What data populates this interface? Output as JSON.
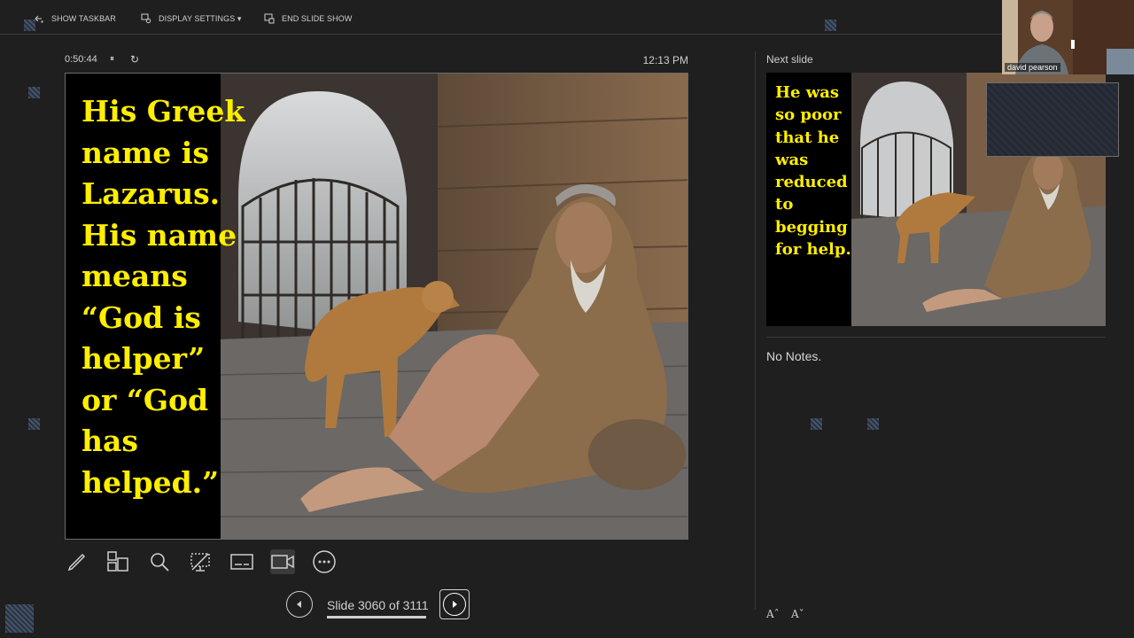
{
  "toolbar": {
    "show_taskbar": "SHOW TASKBAR",
    "display_settings": "DISPLAY SETTINGS ▾",
    "end_slide_show": "END SLIDE SHOW"
  },
  "presenter": {
    "elapsed_time": "0:50:44",
    "pause_icon": "⏸",
    "reset_icon": "↻",
    "clock": "12:13 PM"
  },
  "current_slide": {
    "text_lines": [
      "His Greek",
      "name is",
      "Lazarus.",
      "His name",
      "means",
      "“God is",
      "helper”",
      "or “God",
      "has",
      "helped.”"
    ]
  },
  "tools": [
    {
      "name": "pen-icon",
      "active": false
    },
    {
      "name": "see-all-slides-icon",
      "active": false
    },
    {
      "name": "zoom-icon",
      "active": false
    },
    {
      "name": "black-screen-icon",
      "active": false
    },
    {
      "name": "subtitles-icon",
      "active": false
    },
    {
      "name": "camera-icon",
      "active": true
    },
    {
      "name": "more-options-icon",
      "active": false
    }
  ],
  "navigation": {
    "slide_counter": "Slide 3060 of 3111",
    "current": 3060,
    "total": 3111
  },
  "next_slide": {
    "label": "Next slide",
    "text_lines": [
      "He was",
      "so poor",
      "that he",
      "was",
      "reduced",
      "to",
      "begging",
      "for help."
    ]
  },
  "notes": {
    "text": "No Notes."
  },
  "font_controls": {
    "increase": "Aˆ",
    "decrease": "Aˇ"
  },
  "camera": {
    "participant_name": "david pearson"
  },
  "colors": {
    "background": "#1f1f1f",
    "slide_text": "#ffee00",
    "divider": "#3a3a3a"
  }
}
